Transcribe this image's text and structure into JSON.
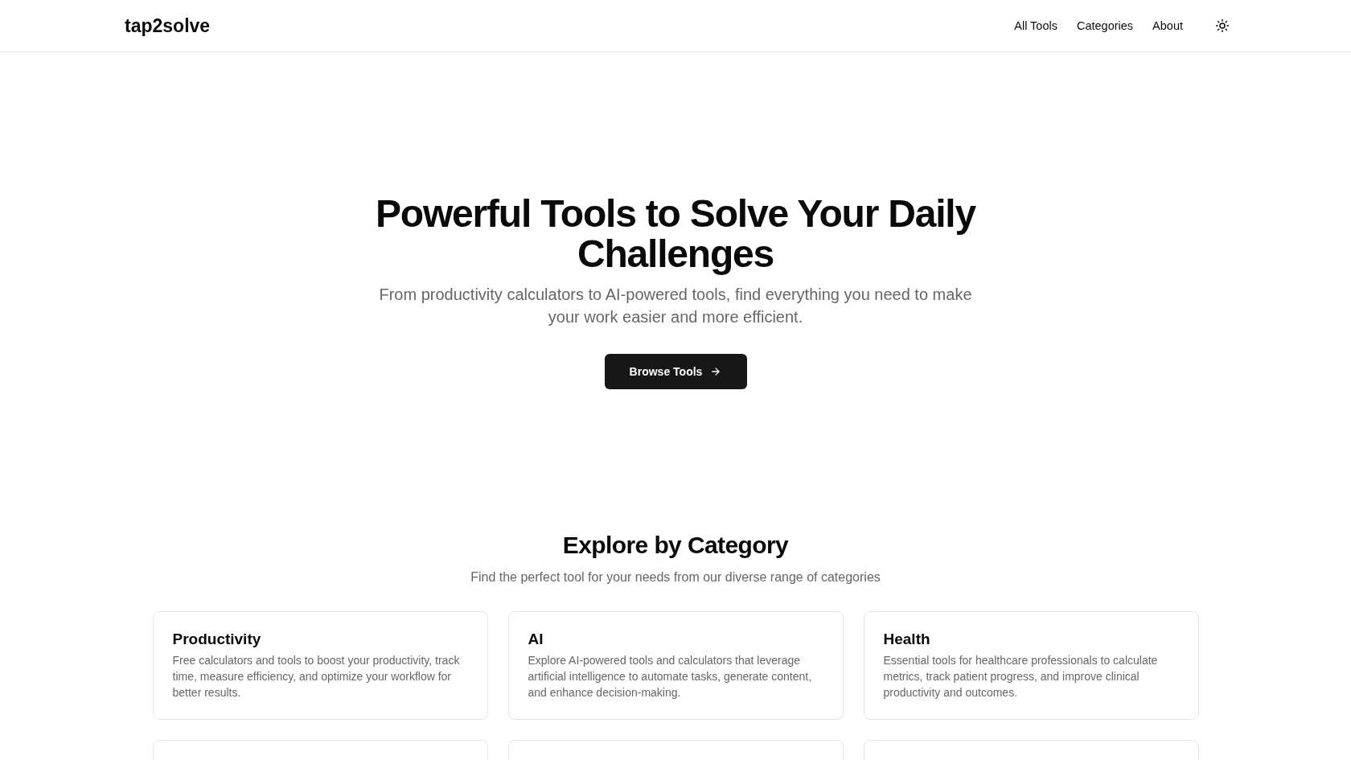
{
  "header": {
    "logo": "tap2solve",
    "nav": [
      {
        "label": "All Tools"
      },
      {
        "label": "Categories"
      },
      {
        "label": "About"
      }
    ]
  },
  "hero": {
    "title": "Powerful Tools to Solve Your Daily Challenges",
    "subtitle": "From productivity calculators to AI-powered tools, find everything you need to make your work easier and more efficient.",
    "button": "Browse Tools"
  },
  "categories": {
    "title": "Explore by Category",
    "subtitle": "Find the perfect tool for your needs from our diverse range of categories",
    "items": [
      {
        "name": "Productivity",
        "description": "Free calculators and tools to boost your productivity, track time, measure efficiency, and optimize your workflow for better results."
      },
      {
        "name": "AI",
        "description": "Explore AI-powered tools and calculators that leverage artificial intelligence to automate tasks, generate content, and enhance decision-making."
      },
      {
        "name": "Health",
        "description": "Essential tools for healthcare professionals to calculate metrics, track patient progress, and improve clinical productivity and outcomes."
      }
    ]
  }
}
